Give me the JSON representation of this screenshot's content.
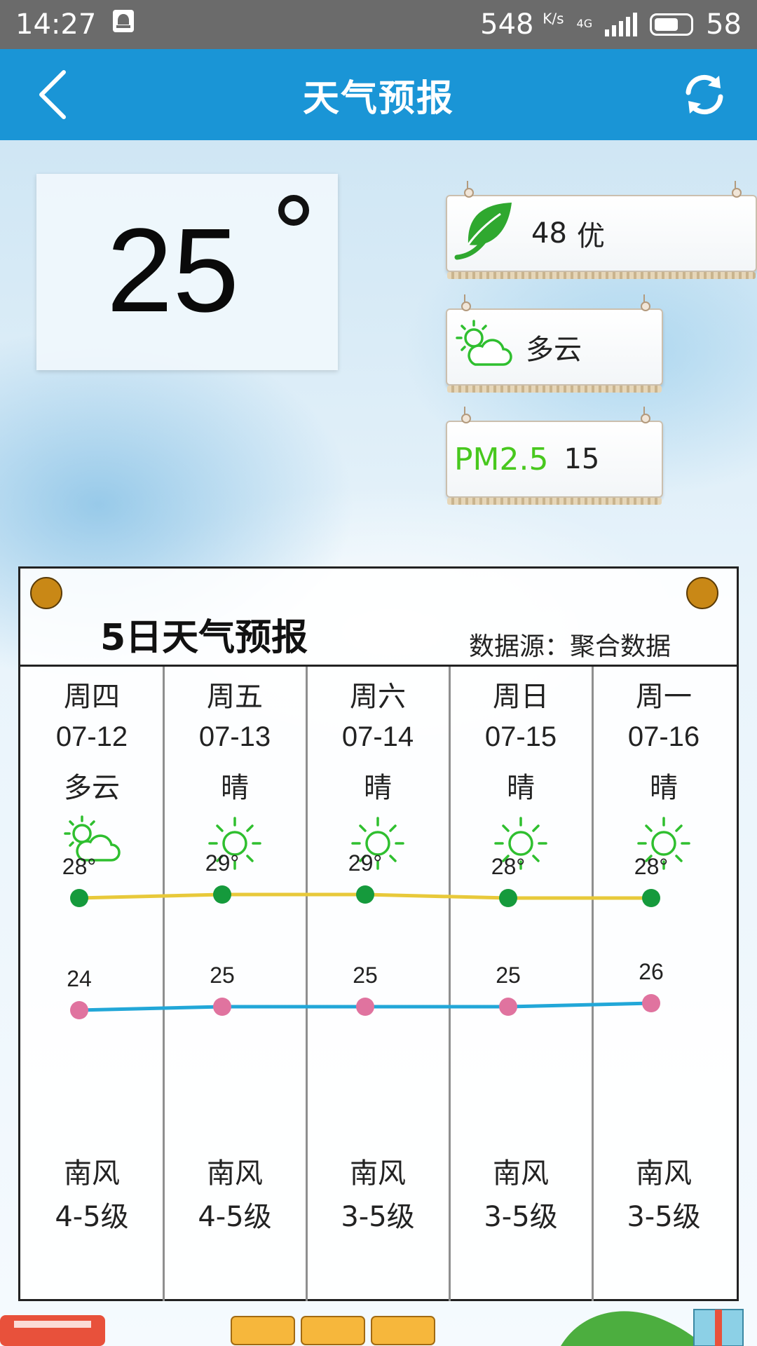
{
  "status_bar": {
    "time": "14:27",
    "net_speed": "548",
    "net_unit": "K/s",
    "network": "4G",
    "battery": "58"
  },
  "app_bar": {
    "title": "天气预报",
    "back_icon": "chevron-left-icon",
    "refresh_icon": "refresh-icon"
  },
  "current": {
    "temperature": "25",
    "aqi_value": "48",
    "aqi_level": "优",
    "condition": "多云",
    "pm_label": "PM2.5",
    "pm_value": "15"
  },
  "forecast": {
    "title": "5日天气预报",
    "source": "数据源：聚合数据",
    "days": [
      {
        "day": "周四",
        "date": "07-12",
        "cond": "多云",
        "icon": "partly-cloudy-icon",
        "high": 28,
        "low": 24,
        "wind_dir": "南风",
        "wind_lvl": "4-5级"
      },
      {
        "day": "周五",
        "date": "07-13",
        "cond": "晴",
        "icon": "sun-icon",
        "high": 29,
        "low": 25,
        "wind_dir": "南风",
        "wind_lvl": "4-5级"
      },
      {
        "day": "周六",
        "date": "07-14",
        "cond": "晴",
        "icon": "sun-icon",
        "high": 29,
        "low": 25,
        "wind_dir": "南风",
        "wind_lvl": "3-5级"
      },
      {
        "day": "周日",
        "date": "07-15",
        "cond": "晴",
        "icon": "sun-icon",
        "high": 28,
        "low": 25,
        "wind_dir": "南风",
        "wind_lvl": "3-5级"
      },
      {
        "day": "周一",
        "date": "07-16",
        "cond": "晴",
        "icon": "sun-icon",
        "high": 28,
        "low": 26,
        "wind_dir": "南风",
        "wind_lvl": "3-5级"
      }
    ],
    "high_line_color": "#e8c93a",
    "low_line_color": "#22a7d8",
    "high_point_color": "#159a3c",
    "low_point_color": "#e0739f",
    "icon_color": "#2fbf2f"
  }
}
